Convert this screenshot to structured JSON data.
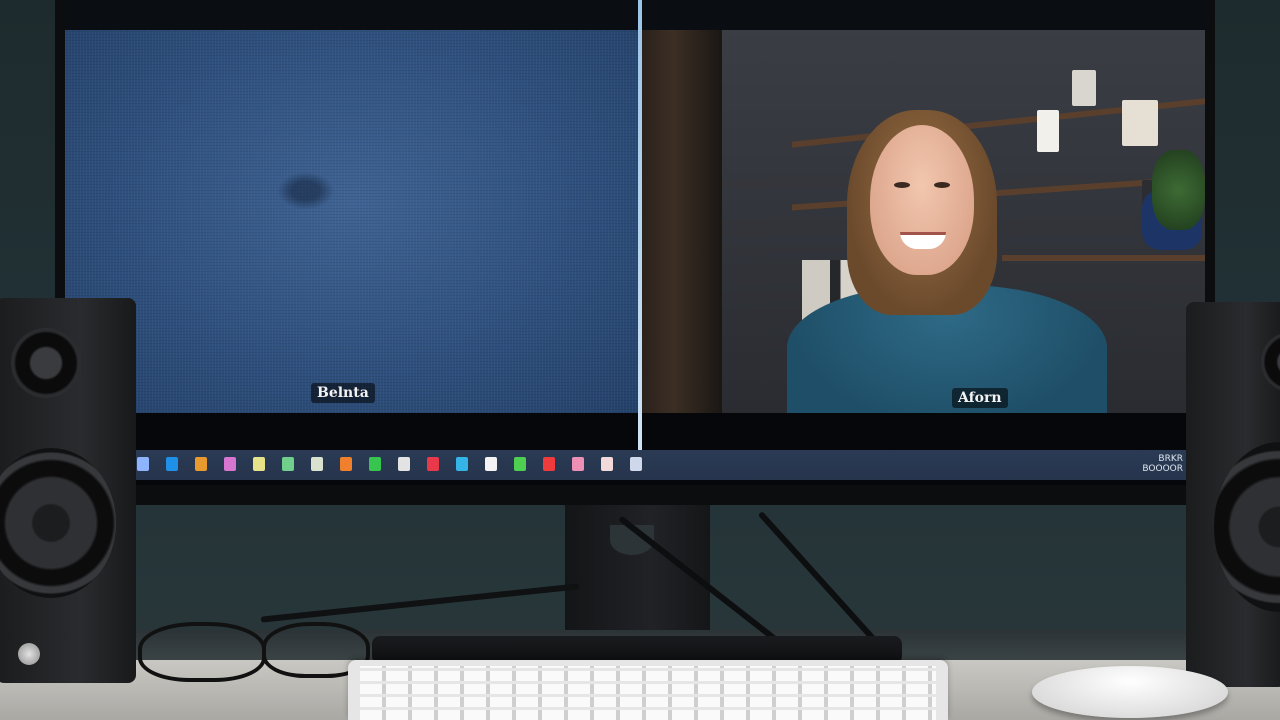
{
  "video_call": {
    "left_participant": {
      "name": "Belnta"
    },
    "right_participant": {
      "name": "Aforn"
    }
  },
  "taskbar": {
    "apps": [
      {
        "icon": "app-icon-1",
        "color": "#8fb4ff"
      },
      {
        "icon": "app-icon-2",
        "color": "#1f8fe8"
      },
      {
        "icon": "app-icon-3",
        "color": "#e99a2f"
      },
      {
        "icon": "app-icon-4",
        "color": "#d776d0"
      },
      {
        "icon": "app-icon-5",
        "color": "#e6e28a"
      },
      {
        "icon": "app-icon-6",
        "color": "#6fcf8b"
      },
      {
        "icon": "app-icon-7",
        "color": "#d8e2cf"
      },
      {
        "icon": "app-icon-8",
        "color": "#f0802b"
      },
      {
        "icon": "app-icon-9",
        "color": "#37c54f"
      },
      {
        "icon": "app-icon-10",
        "color": "#e3e3e3"
      },
      {
        "icon": "app-icon-11",
        "color": "#e8384a"
      },
      {
        "icon": "app-icon-12",
        "color": "#35b4e8"
      },
      {
        "icon": "app-icon-13",
        "color": "#f3f3f3"
      },
      {
        "icon": "app-icon-14",
        "color": "#4fcf52"
      },
      {
        "icon": "app-icon-15",
        "color": "#ef3b3b"
      },
      {
        "icon": "app-icon-16",
        "color": "#ee8fb6"
      },
      {
        "icon": "app-icon-17",
        "color": "#f3dada"
      },
      {
        "icon": "app-icon-18",
        "color": "#cfd7ea"
      }
    ],
    "tray_line_1": "BRKR",
    "tray_line_2": "BOOOOR"
  }
}
